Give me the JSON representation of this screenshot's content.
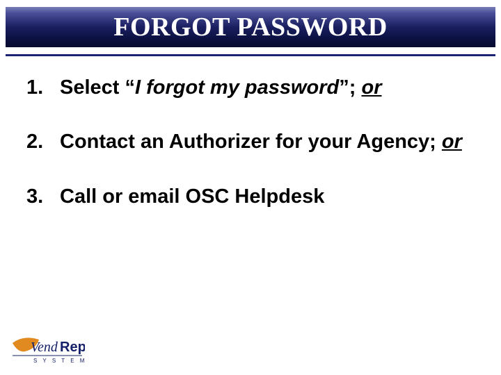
{
  "title": "FORGOT PASSWORD",
  "items": [
    {
      "num": "1.",
      "prefix": "Select “",
      "italic": "I forgot my password",
      "suffix": "”; ",
      "or": "or"
    },
    {
      "num": "2.",
      "prefix": "Contact an Authorizer for your Agency; ",
      "italic": "",
      "suffix": "",
      "or": "or"
    },
    {
      "num": "3.",
      "prefix": "Call or email OSC Helpdesk",
      "italic": "",
      "suffix": "",
      "or": ""
    }
  ],
  "logo": {
    "brand_italic": "Vend",
    "brand_plain": "Rep",
    "subtext": "S Y S T E M"
  }
}
